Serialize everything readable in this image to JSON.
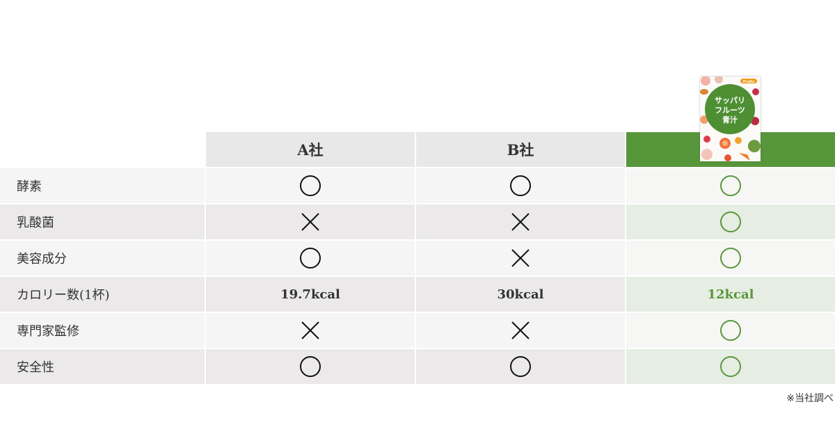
{
  "header": {
    "col_a": "A社",
    "col_b": "B社",
    "col_c_product": {
      "badge": "Fruits",
      "name_line1": "サッパリ",
      "name_line2": "フルーツ",
      "name_line3": "青汁"
    }
  },
  "rows": [
    {
      "label": "酵素",
      "a": "circle",
      "b": "circle",
      "c": "circle"
    },
    {
      "label": "乳酸菌",
      "a": "cross",
      "b": "cross",
      "c": "circle"
    },
    {
      "label": "美容成分",
      "a": "circle",
      "b": "cross",
      "c": "circle"
    },
    {
      "label": "カロリー数(1杯)",
      "a": "19.7kcal",
      "b": "30kcal",
      "c": "12kcal"
    },
    {
      "label": "専門家監修",
      "a": "cross",
      "b": "cross",
      "c": "circle"
    },
    {
      "label": "安全性",
      "a": "circle",
      "b": "circle",
      "c": "circle"
    }
  ],
  "footnote": "※当社調べ",
  "colors": {
    "accent_green": "#58963c",
    "header_gray": "#e9e8e8",
    "mark_black": "#111111"
  }
}
